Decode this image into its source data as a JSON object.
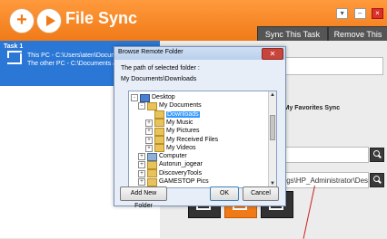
{
  "app": {
    "title": "File Sync",
    "sync_task_label": "Sync This Task",
    "remove_task_label": "Remove This Task",
    "colors": {
      "accent": "#f07a18",
      "selection": "#2a77d6"
    }
  },
  "tasks": [
    {
      "title": "Task 1",
      "line1": "This PC - C:\\Users\\aten\\Docume",
      "line2": "The other PC - C:\\Documents an"
    }
  ],
  "config": {
    "favorites_label": "E My Favorites Sync",
    "path1": "ts",
    "path2": "ings\\HP_Administrator\\Deskt"
  },
  "dialog": {
    "title": "Browse Remote Folder",
    "path_label": "The path of selected folder :",
    "path_value": "My Documents\\Downloads",
    "add_folder_label": "Add New Folder",
    "ok_label": "OK",
    "cancel_label": "Cancel",
    "tree": [
      {
        "label": "Desktop",
        "icon": "desktop",
        "indent": 0,
        "expander": "-"
      },
      {
        "label": "My Documents",
        "icon": "folder",
        "indent": 1,
        "expander": "-"
      },
      {
        "label": "Downloads",
        "icon": "folder",
        "indent": 2,
        "expander": "",
        "selected": true
      },
      {
        "label": "My Music",
        "icon": "folder",
        "indent": 2,
        "expander": "+"
      },
      {
        "label": "My Pictures",
        "icon": "folder",
        "indent": 2,
        "expander": "+"
      },
      {
        "label": "My Received Files",
        "icon": "folder",
        "indent": 2,
        "expander": "+"
      },
      {
        "label": "My Videos",
        "icon": "folder",
        "indent": 2,
        "expander": "+"
      },
      {
        "label": "Computer",
        "icon": "computer",
        "indent": 1,
        "expander": "+"
      },
      {
        "label": "Autorun_jogear",
        "icon": "folder",
        "indent": 1,
        "expander": "+"
      },
      {
        "label": "DiscoveryTools",
        "icon": "folder",
        "indent": 1,
        "expander": "+"
      },
      {
        "label": "GAMESTOP Pics",
        "icon": "folder",
        "indent": 1,
        "expander": "+"
      }
    ]
  }
}
